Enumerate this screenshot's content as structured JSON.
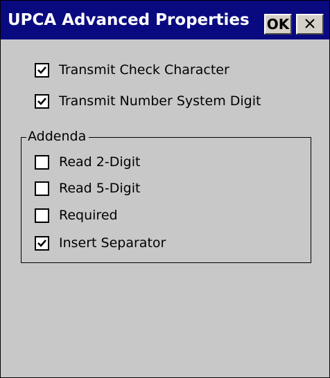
{
  "window": {
    "title": "UPCA Advanced Properties",
    "ok_label": "OK",
    "close_icon": "close-icon",
    "colors": {
      "titlebar": "#0a0a80",
      "background": "#c8c8c8"
    }
  },
  "options": [
    {
      "label": "Transmit Check Character",
      "checked": true
    },
    {
      "label": "Transmit Number System Digit",
      "checked": true
    }
  ],
  "addenda": {
    "label": "Addenda",
    "items": [
      {
        "label": "Read 2-Digit",
        "checked": false
      },
      {
        "label": "Read 5-Digit",
        "checked": false
      },
      {
        "label": "Required",
        "checked": false
      },
      {
        "label": "Insert Separator",
        "checked": true
      }
    ]
  }
}
